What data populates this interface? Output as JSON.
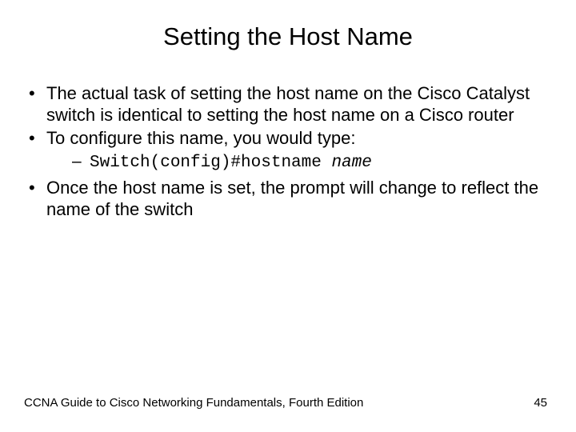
{
  "title": "Setting the Host Name",
  "bullets": {
    "b1": "The actual task of setting the host name on the Cisco Catalyst switch is identical to setting the host name on a Cisco router",
    "b2": "To configure this name, you would type:",
    "sub1_cmd": "Switch(config)#hostname ",
    "sub1_arg": "name",
    "b3": "Once the host name is set, the prompt will change to reflect the name of the switch"
  },
  "footer": {
    "text": "CCNA Guide to Cisco Networking Fundamentals, Fourth Edition",
    "page": "45"
  }
}
